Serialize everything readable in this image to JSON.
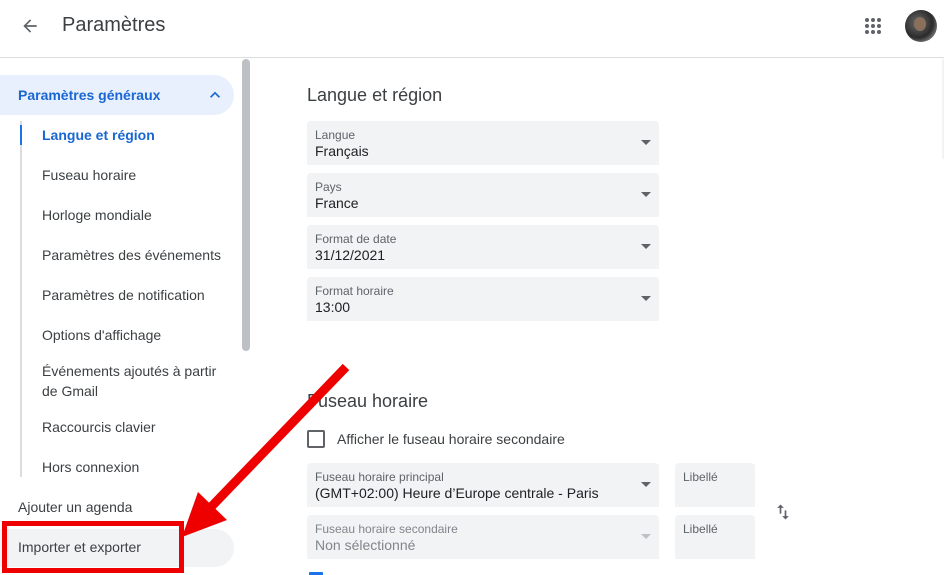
{
  "header": {
    "title": "Paramètres",
    "back_icon": "arrow-back-icon",
    "apps_icon": "apps-grid-icon",
    "avatar_icon": "user-avatar"
  },
  "sidebar": {
    "section": {
      "label": "Paramètres généraux",
      "expanded": true,
      "items": [
        {
          "label": "Langue et région",
          "active": true
        },
        {
          "label": "Fuseau horaire",
          "active": false
        },
        {
          "label": "Horloge mondiale",
          "active": false
        },
        {
          "label": "Paramètres des événements",
          "active": false
        },
        {
          "label": "Paramètres de notification",
          "active": false
        },
        {
          "label": "Options d'affichage",
          "active": false
        },
        {
          "label": "Événements ajoutés à partir de Gmail",
          "active": false
        },
        {
          "label": "Raccourcis clavier",
          "active": false
        },
        {
          "label": "Hors connexion",
          "active": false
        }
      ]
    },
    "add_calendar": "Ajouter un agenda",
    "import_export": "Importer et exporter"
  },
  "main": {
    "language_region": {
      "title": "Langue et région",
      "fields": [
        {
          "label": "Langue",
          "value": "Français"
        },
        {
          "label": "Pays",
          "value": "France"
        },
        {
          "label": "Format de date",
          "value": "31/12/2021"
        },
        {
          "label": "Format horaire",
          "value": "13:00"
        }
      ]
    },
    "timezone": {
      "title": "Fuseau horaire",
      "secondary_checkbox_label": "Afficher le fuseau horaire secondaire",
      "primary": {
        "label": "Fuseau horaire principal",
        "value": "(GMT+02:00) Heure d’Europe centrale - Paris"
      },
      "secondary": {
        "label": "Fuseau horaire secondaire",
        "value": "Non sélectionné"
      },
      "primary_label_field": "Libellé",
      "secondary_label_field": "Libellé",
      "swap_icon": "swap-vertical-icon"
    }
  },
  "colors": {
    "accent": "#1a73e8",
    "accent_text": "#1967d2",
    "active_bg": "#e8f0fe",
    "field_bg": "#f1f3f4",
    "annotation": "#ee0000"
  }
}
